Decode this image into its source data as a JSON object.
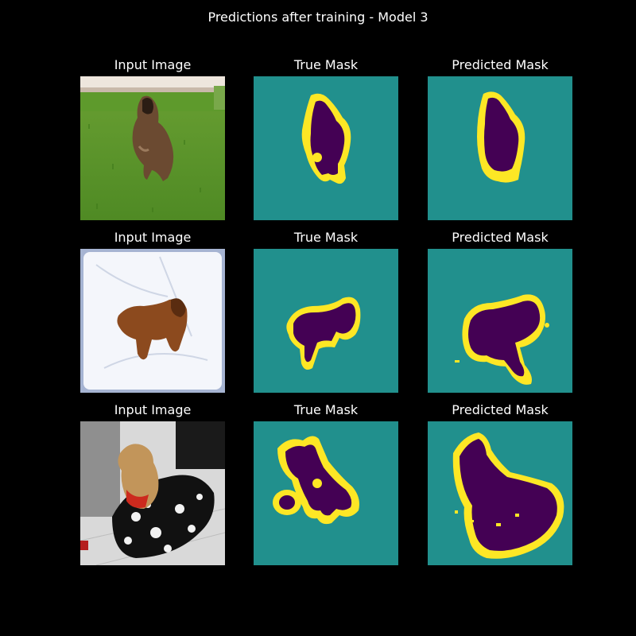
{
  "figure": {
    "title": "Predictions after training - Model 3"
  },
  "rows": [
    {
      "input_title": "Input Image",
      "true_title": "True Mask",
      "pred_title": "Predicted Mask",
      "input_description": "brown long-haired dog running on green grass"
    },
    {
      "input_title": "Input Image",
      "true_title": "True Mask",
      "pred_title": "Predicted Mask",
      "input_description": "brown spaniel standing in snow"
    },
    {
      "input_title": "Input Image",
      "true_title": "True Mask",
      "pred_title": "Predicted Mask",
      "input_description": "yorkshire terrier on black and white dog bed"
    }
  ],
  "colors": {
    "background": "#000000",
    "mask_background": "#21908d",
    "mask_foreground": "#440154",
    "mask_border": "#fde725"
  }
}
